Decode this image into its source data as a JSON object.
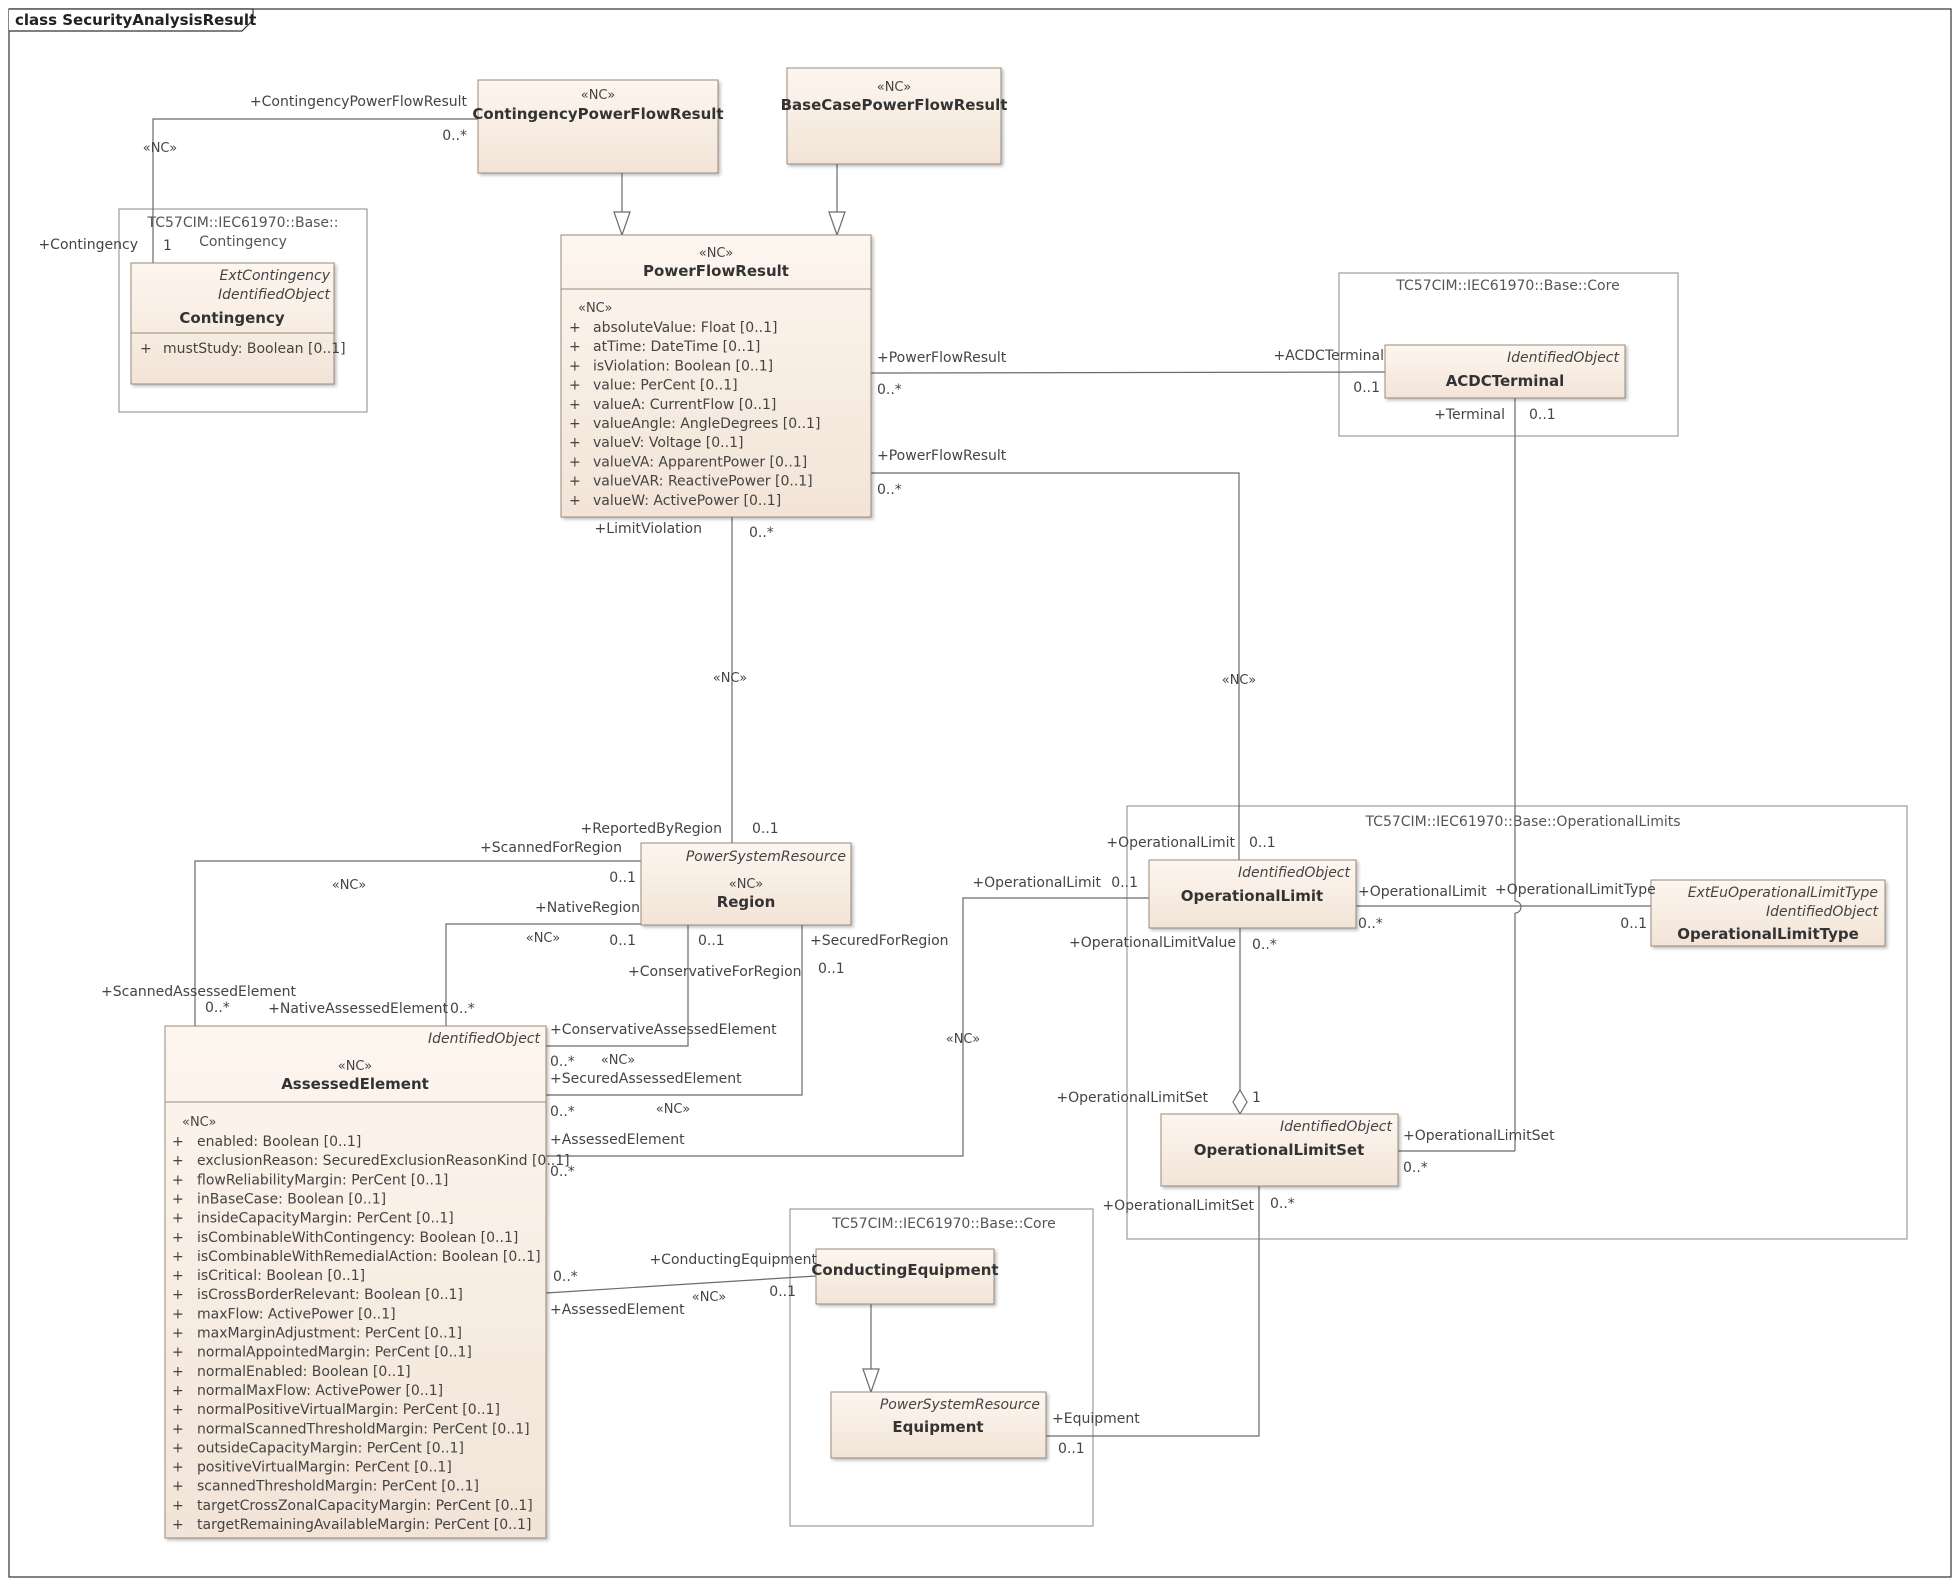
{
  "frame": {
    "title": "class SecurityAnalysisResult"
  },
  "packages": {
    "contingency_pkg": {
      "line1": "TC57CIM::IEC61970::Base::",
      "line2": "Contingency"
    },
    "core_top": {
      "label": "TC57CIM::IEC61970::Base::Core"
    },
    "oplimits": {
      "label": "TC57CIM::IEC61970::Base::OperationalLimits"
    },
    "core_bottom": {
      "label": "TC57CIM::IEC61970::Base::Core"
    }
  },
  "classes": {
    "contingency_pf": {
      "stereotype": "«NC»",
      "name": "ContingencyPowerFlowResult"
    },
    "basecase_pf": {
      "stereotype": "«NC»",
      "name": "BaseCasePowerFlowResult"
    },
    "contingency": {
      "parent1": "ExtContingency",
      "parent2": "IdentifiedObject",
      "name": "Contingency",
      "attributes": [
        "mustStudy: Boolean [0..1]"
      ]
    },
    "powerflow": {
      "stereotype": "«NC»",
      "name": "PowerFlowResult",
      "attr_stereotype": "«NC»",
      "attributes": [
        "absoluteValue: Float [0..1]",
        "atTime: DateTime [0..1]",
        "isViolation: Boolean [0..1]",
        "value: PerCent [0..1]",
        "valueA: CurrentFlow [0..1]",
        "valueAngle: AngleDegrees [0..1]",
        "valueV: Voltage [0..1]",
        "valueVA: ApparentPower [0..1]",
        "valueVAR: ReactivePower [0..1]",
        "valueW: ActivePower [0..1]"
      ]
    },
    "acdc": {
      "parent": "IdentifiedObject",
      "name": "ACDCTerminal"
    },
    "region": {
      "parent": "PowerSystemResource",
      "stereotype": "«NC»",
      "name": "Region"
    },
    "oplimit": {
      "parent": "IdentifiedObject",
      "name": "OperationalLimit"
    },
    "oplimittype": {
      "parent1": "ExtEuOperationalLimitType",
      "parent2": "IdentifiedObject",
      "name": "OperationalLimitType"
    },
    "oplimitset": {
      "parent": "IdentifiedObject",
      "name": "OperationalLimitSet"
    },
    "assessed": {
      "parent": "IdentifiedObject",
      "stereotype": "«NC»",
      "name": "AssessedElement",
      "attr_stereotype": "«NC»",
      "attributes": [
        "enabled: Boolean [0..1]",
        "exclusionReason: SecuredExclusionReasonKind [0..1]",
        "flowReliabilityMargin: PerCent [0..1]",
        "inBaseCase: Boolean [0..1]",
        "insideCapacityMargin: PerCent [0..1]",
        "isCombinableWithContingency: Boolean [0..1]",
        "isCombinableWithRemedialAction: Boolean [0..1]",
        "isCritical: Boolean [0..1]",
        "isCrossBorderRelevant: Boolean [0..1]",
        "maxFlow: ActivePower [0..1]",
        "maxMarginAdjustment: PerCent [0..1]",
        "normalAppointedMargin: PerCent [0..1]",
        "normalEnabled: Boolean [0..1]",
        "normalMaxFlow: ActivePower [0..1]",
        "normalPositiveVirtualMargin: PerCent [0..1]",
        "normalScannedThresholdMargin: PerCent [0..1]",
        "outsideCapacityMargin: PerCent [0..1]",
        "positiveVirtualMargin: PerCent [0..1]",
        "scannedThresholdMargin: PerCent [0..1]",
        "targetCrossZonalCapacityMargin: PerCent [0..1]",
        "targetRemainingAvailableMargin: PerCent [0..1]"
      ]
    },
    "conducting": {
      "name": "ConductingEquipment"
    },
    "equipment": {
      "parent": "PowerSystemResource",
      "name": "Equipment"
    }
  },
  "visibility_marker": "+",
  "connector_labels": {
    "cpfr_role": "+ContingencyPowerFlowResult",
    "cpfr_mult": "0..*",
    "cont_nc": "«NC»",
    "cont_role": "+Contingency",
    "cont_mult": "1",
    "pf_acdc_role": "+PowerFlowResult",
    "pf_acdc_mult": "0..*",
    "acdc_role": "+ACDCTerminal",
    "acdc_mult": "0..1",
    "terminal_role": "+Terminal",
    "terminal_mult": "0..1",
    "pf_ol_role": "+PowerFlowResult",
    "pf_ol_mult": "0..*",
    "limitviol_role": "+LimitViolation",
    "limitviol_mult": "0..*",
    "nc_pf_region": "«NC»",
    "nc_pf_ol": "«NC»",
    "reportedby_role": "+ReportedByRegion",
    "reportedby_mult": "0..1",
    "scannedfor_role": "+ScannedForRegion",
    "scannedfor_mult": "0..1",
    "nc_scanned": "«NC»",
    "native_role": "+NativeRegion",
    "native_mult": "0..1",
    "nc_native": "«NC»",
    "cons_mult": "0..1",
    "cons_role": "+ConservativeForRegion",
    "secured_role": "+SecuredForRegion",
    "secured_mult": "0..1",
    "scannedassessed_role": "+ScannedAssessedElement",
    "scannedassessed_mult": "0..*",
    "nativeassessed_role": "+NativeAssessedElement",
    "nativeassessed_mult": "0..*",
    "consassessed_role": "+ConservativeAssessedElement",
    "consassessed_mult": "0..*",
    "nc_cons": "«NC»",
    "securedassessed_role": "+SecuredAssessedElement",
    "securedassessed_mult": "0..*",
    "nc_secured": "«NC»",
    "ae_ol_role": "+AssessedElement",
    "ae_ol_mult": "0..*",
    "nc_ae_ol": "«NC»",
    "ol_ae_role": "+OperationalLimit",
    "ol_ae_mult": "0..1",
    "ol_pf_role": "+OperationalLimit",
    "ol_pf_mult": "0..1",
    "ol_type_role": "+OperationalLimit",
    "ol_type_mult": "0..*",
    "oltype_role": "+OperationalLimitType",
    "oltype_mult": "0..1",
    "olvalue_role": "+OperationalLimitValue",
    "olvalue_mult": "0..*",
    "olset_role": "+OperationalLimitSet",
    "olset_mult": "1",
    "olset_term_role": "+OperationalLimitSet",
    "olset_term_mult": "0..*",
    "olset_eq_role": "+OperationalLimitSet",
    "olset_eq_mult": "0..*",
    "ce_role": "+ConductingEquipment",
    "ce_mult": "0..1",
    "ae_ce_mult": "0..*",
    "ae_ce_role": "+AssessedElement",
    "nc_ae_ce": "«NC»",
    "equip_role": "+Equipment",
    "equip_mult": "0..1"
  },
  "colors": {
    "class_fill_top": "#fdf6ef",
    "class_fill_bottom": "#f2e4d7",
    "class_border": "#9a8a7c",
    "line": "#6b6b6b",
    "frame": "#333333"
  }
}
